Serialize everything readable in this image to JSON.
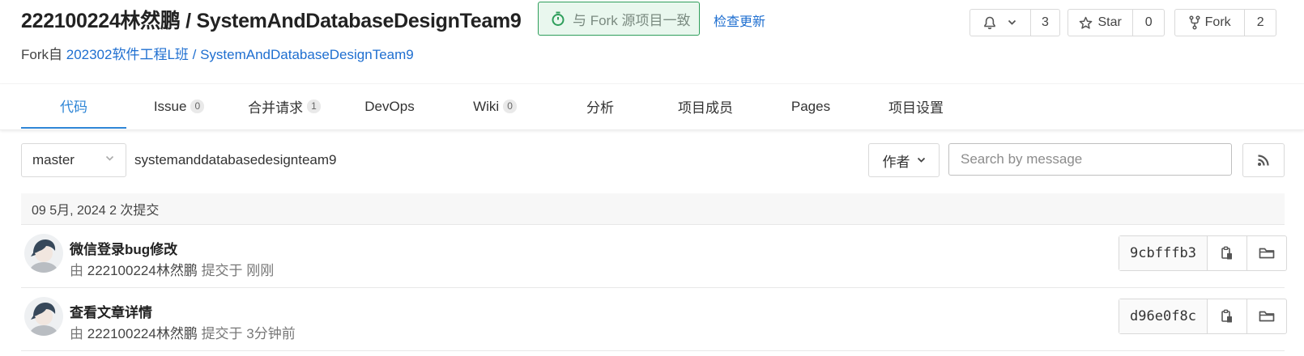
{
  "header": {
    "title": "222100224林然鹏 / SystemAndDatabaseDesignTeam9",
    "sync_label": "与 Fork 源项目一致",
    "check_update": "检查更新",
    "fork_prefix": "Fork自",
    "fork_source": "202302软件工程L班 / SystemAndDatabaseDesignTeam9",
    "watch_count": "3",
    "star_label": "Star",
    "star_count": "0",
    "fork_label": "Fork",
    "fork_count": "2"
  },
  "tabs": [
    {
      "label": "代码",
      "badge": ""
    },
    {
      "label": "Issue",
      "badge": "0"
    },
    {
      "label": "合并请求",
      "badge": "1"
    },
    {
      "label": "DevOps",
      "badge": ""
    },
    {
      "label": "Wiki",
      "badge": "0"
    },
    {
      "label": "分析",
      "badge": ""
    },
    {
      "label": "项目成员",
      "badge": ""
    },
    {
      "label": "Pages",
      "badge": ""
    },
    {
      "label": "项目设置",
      "badge": ""
    }
  ],
  "toolbar": {
    "branch": "master",
    "path": "systemanddatabasedesignteam9",
    "author_filter": "作者",
    "search_placeholder": "Search by message"
  },
  "commits": {
    "day_header": "09 5月, 2024 2 次提交",
    "items": [
      {
        "title": "微信登录bug修改",
        "by": "由",
        "author": "222100224林然鹏",
        "committed": "提交于",
        "when": "刚刚",
        "sha": "9cbfffb3"
      },
      {
        "title": "查看文章详情",
        "by": "由",
        "author": "222100224林然鹏",
        "committed": "提交于",
        "when": "3分钟前",
        "sha": "d96e0f8c"
      }
    ]
  },
  "colors": {
    "accent": "#2f86d6",
    "link": "#1f6fd0",
    "sync_border": "#2e9e5b"
  },
  "icons": [
    "stopwatch-icon",
    "bell-icon",
    "chevron-down-icon",
    "star-icon",
    "fork-icon",
    "rss-icon",
    "copy-icon",
    "folder-icon"
  ]
}
